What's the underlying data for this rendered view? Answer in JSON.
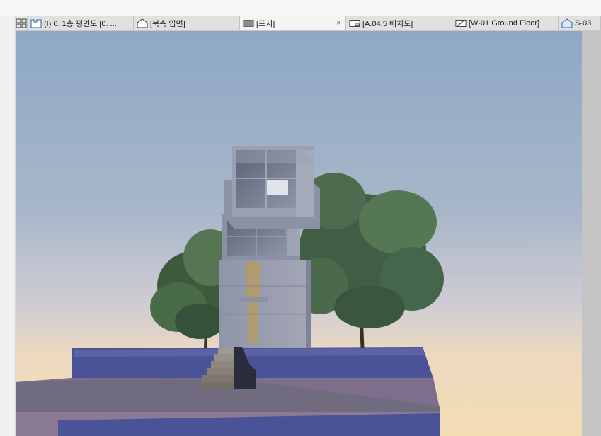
{
  "tabs": [
    {
      "label": "(!) 0. 1층 평면도 [0. ...",
      "icon": "floor-plan-icon"
    },
    {
      "label": "[북측 입면]",
      "icon": "elevation-icon"
    },
    {
      "label": "[표지]",
      "icon": "layout-icon",
      "active": true,
      "close": "×"
    },
    {
      "label": "[A.04.5 배치도]",
      "icon": "sheet-icon"
    },
    {
      "label": "[W-01 Ground Floor]",
      "icon": "worksheet-icon"
    },
    {
      "label": "S-03",
      "icon": "section-icon"
    }
  ],
  "viewport": {
    "content": "3d-render-tower-house-with-trees",
    "colors": {
      "sky_top": "#8ea8c4",
      "sky_horizon": "#f3ddb3",
      "ground": "#4a5398",
      "slab": "#8a7a96"
    }
  }
}
